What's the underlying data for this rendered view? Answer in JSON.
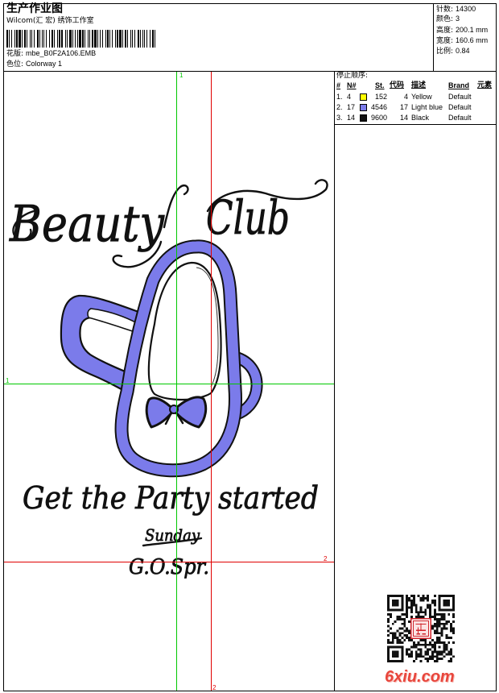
{
  "header": {
    "title": "生产作业图",
    "studio": "Wilcom(汇 宏) 绣饰工作室",
    "design_label": "花版:",
    "design_file": "mbe_B0F2A106.EMB",
    "colorway_label": "色位:",
    "colorway": "Colorway 1"
  },
  "stats": {
    "stitches_label": "针数:",
    "stitches": "14300",
    "colors_label": "颜色:",
    "colors": "3",
    "height_label": "高度:",
    "height": "200.1 mm",
    "width_label": "宽度:",
    "width": "160.6 mm",
    "scale_label": "比例:",
    "scale": "0.84"
  },
  "stop_sequence": {
    "title": "停止顺序:",
    "columns": [
      "#",
      "N#",
      "St.",
      "代码",
      "描述",
      "Brand",
      "元素"
    ],
    "rows": [
      {
        "index": "1.",
        "n": "4",
        "color": "#ffff00",
        "stitches": "152",
        "code": "4",
        "description": "Yellow",
        "brand": "Default"
      },
      {
        "index": "2.",
        "n": "17",
        "color": "#7b7bea",
        "stitches": "4546",
        "code": "17",
        "description": "Light blue",
        "brand": "Default"
      },
      {
        "index": "3.",
        "n": "14",
        "color": "#111111",
        "stitches": "9600",
        "code": "14",
        "description": "Black",
        "brand": "Default"
      }
    ]
  },
  "design": {
    "title_word1": "Beauty",
    "title_word2": "Club",
    "slogan": "Get the Party started",
    "line3": "Sunday",
    "line4": "G.O.Spr.",
    "thread_colors": {
      "blue": "#7b7bea",
      "black": "#111111"
    }
  },
  "guides": {
    "v1_label": "1",
    "h1_label": "1",
    "v2_label": "2",
    "h2_label": "2",
    "green": "#00c800",
    "red": "#e00000"
  },
  "watermark": {
    "text": "6xiu.com",
    "color": "#e8463c"
  }
}
